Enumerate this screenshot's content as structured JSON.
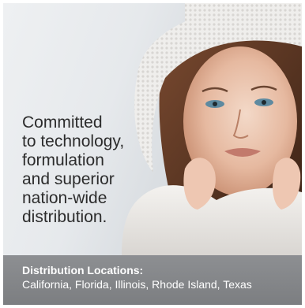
{
  "banner": {
    "image_icon": "woman-in-knit-hat-image",
    "tagline_lines": [
      "Committed",
      "to technology,",
      "formulation",
      "and superior",
      "nation-wide",
      "distribution."
    ],
    "colors": {
      "text": "#2c2c2c",
      "footer_bar": "#848689",
      "footer_text": "#ffffff"
    }
  },
  "footer": {
    "heading": "Distribution Locations:",
    "locations": "California, Florida, Illinois, Rhode Island, Texas"
  }
}
